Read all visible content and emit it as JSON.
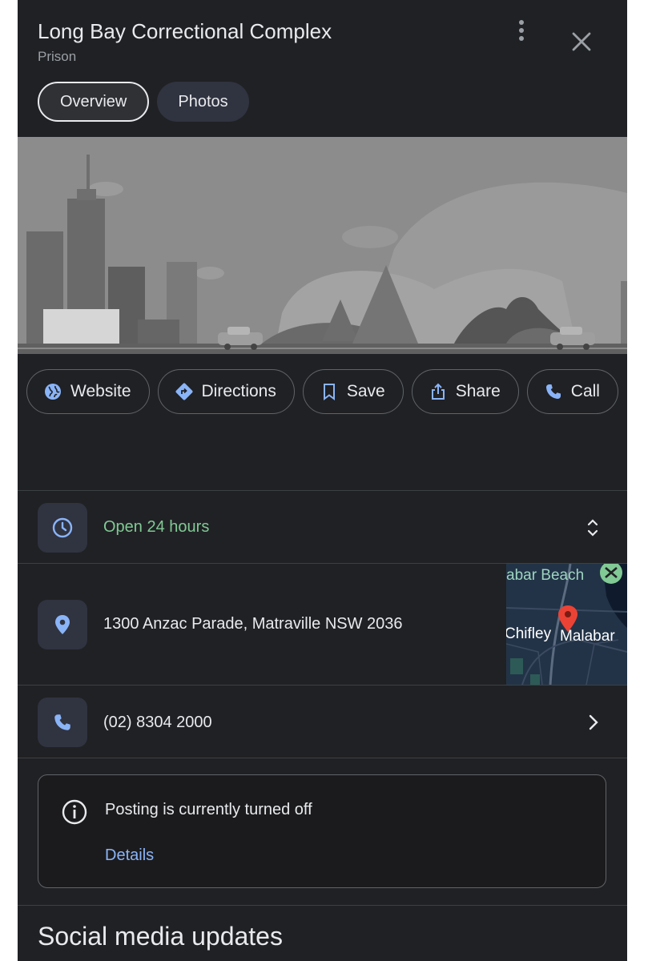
{
  "place": {
    "name": "Long Bay Correctional Complex",
    "category": "Prison"
  },
  "tabs": [
    {
      "label": "Overview",
      "active": true
    },
    {
      "label": "Photos",
      "active": false
    }
  ],
  "actions": {
    "website": "Website",
    "directions": "Directions",
    "save": "Save",
    "share": "Share",
    "call": "Call"
  },
  "hours": {
    "status": "Open 24 hours",
    "color": "#81c995"
  },
  "address": {
    "text": "1300 Anzac Parade, Matraville NSW 2036",
    "map_labels": {
      "beach": "abar Beach",
      "suburb1": "Chifley",
      "suburb2": "Malabar"
    }
  },
  "phone": {
    "number": "(02) 8304 2000"
  },
  "notice": {
    "message": "Posting is currently turned off",
    "link": "Details"
  },
  "sections": {
    "social": "Social media updates"
  },
  "colors": {
    "accent_blue": "#8ab4f8",
    "pin_red": "#ea4335",
    "panel_bg": "#202124"
  }
}
